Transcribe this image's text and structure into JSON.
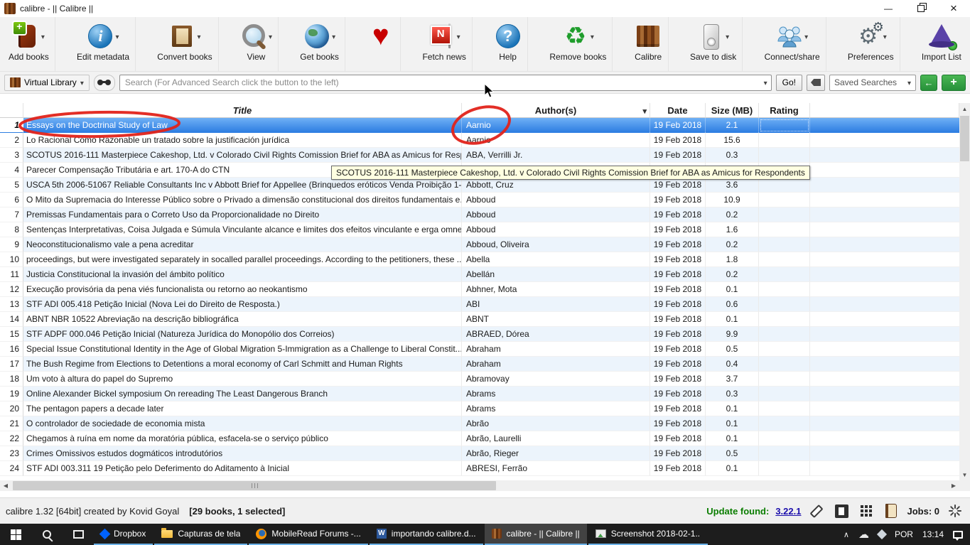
{
  "window": {
    "title": "calibre - || Calibre ||"
  },
  "toolbar": {
    "items": [
      {
        "label": "Add books"
      },
      {
        "label": "Edit metadata"
      },
      {
        "label": "Convert books"
      },
      {
        "label": "View"
      },
      {
        "label": "Get books"
      },
      {
        "label": ""
      },
      {
        "label": "Fetch news"
      },
      {
        "label": "Help"
      },
      {
        "label": "Remove books"
      },
      {
        "label": "Calibre"
      },
      {
        "label": "Save to disk"
      },
      {
        "label": "Connect/share"
      },
      {
        "label": "Preferences"
      },
      {
        "label": "Import List"
      }
    ]
  },
  "search": {
    "virtual_library": "Virtual Library",
    "placeholder": "Search (For Advanced Search click the button to the left)",
    "go": "Go!",
    "saved_searches": "Saved Searches"
  },
  "table": {
    "columns": {
      "title": "Title",
      "author": "Author(s)",
      "date": "Date",
      "size": "Size (MB)",
      "rating": "Rating"
    },
    "rows": [
      {
        "num": "1",
        "title": "Essays on the Doctrinal Study of Law",
        "author": "Aarnio",
        "date": "19 Feb 2018",
        "size": "2.1",
        "rating": "",
        "selected": true
      },
      {
        "num": "2",
        "title": "Lo Racional Como Razonable un tratado sobre la justificación jurídica",
        "author": "Aarnio",
        "date": "19 Feb 2018",
        "size": "15.6",
        "rating": ""
      },
      {
        "num": "3",
        "title": "SCOTUS 2016-111 Masterpiece Cakeshop, Ltd. v Colorado Civil Rights Comission Brief for ABA as Amicus for Resp...",
        "author": "ABA, Verrilli Jr.",
        "date": "19 Feb 2018",
        "size": "0.3",
        "rating": ""
      },
      {
        "num": "4",
        "title": "Parecer Compensação Tributária e art. 170-A do CTN",
        "author": "",
        "date": "",
        "size": "",
        "rating": ""
      },
      {
        "num": "5",
        "title": "USCA 5th 2006-51067 Reliable Consultants Inc v Abbott Brief for Appellee (Brinquedos eróticos Venda Proibição 1-...",
        "author": "Abbott, Cruz",
        "date": "19 Feb 2018",
        "size": "3.6",
        "rating": ""
      },
      {
        "num": "6",
        "title": "O Mito da Supremacia do Interesse Público sobre o Privado a dimensão constitucional dos direitos fundamentais e...",
        "author": "Abboud",
        "date": "19 Feb 2018",
        "size": "10.9",
        "rating": ""
      },
      {
        "num": "7",
        "title": "Premissas Fundamentais para o Correto Uso da Proporcionalidade no Direito",
        "author": "Abboud",
        "date": "19 Feb 2018",
        "size": "0.2",
        "rating": ""
      },
      {
        "num": "8",
        "title": "Sentenças Interpretativas, Coisa Julgada e Súmula Vinculante alcance e limites dos efeitos vinculante e erga omnes...",
        "author": "Abboud",
        "date": "19 Feb 2018",
        "size": "1.6",
        "rating": ""
      },
      {
        "num": "9",
        "title": "Neoconstitucionalismo vale a pena acreditar",
        "author": "Abboud, Oliveira",
        "date": "19 Feb 2018",
        "size": "0.2",
        "rating": ""
      },
      {
        "num": "10",
        "title": "proceedings, but were investigated separately in socalled parallel proceedings. According to the petitioners, these ...",
        "author": "Abella",
        "date": "19 Feb 2018",
        "size": "1.8",
        "rating": ""
      },
      {
        "num": "11",
        "title": "Justicia Constitucional la invasión del ámbito político",
        "author": "Abellán",
        "date": "19 Feb 2018",
        "size": "0.2",
        "rating": ""
      },
      {
        "num": "12",
        "title": "Execução provisória da pena viés funcionalista ou retorno ao neokantismo",
        "author": "Abhner, Mota",
        "date": "19 Feb 2018",
        "size": "0.1",
        "rating": ""
      },
      {
        "num": "13",
        "title": "STF ADI 005.418 Petição Inicial (Nova Lei do Direito de Resposta.)",
        "author": "ABI",
        "date": "19 Feb 2018",
        "size": "0.6",
        "rating": ""
      },
      {
        "num": "14",
        "title": "ABNT NBR 10522 Abreviação na descrição bibliográfica",
        "author": "ABNT",
        "date": "19 Feb 2018",
        "size": "0.1",
        "rating": ""
      },
      {
        "num": "15",
        "title": "STF ADPF 000.046 Petição Inicial (Natureza Jurídica do Monopólio dos Correios)",
        "author": "ABRAED, Dórea",
        "date": "19 Feb 2018",
        "size": "9.9",
        "rating": ""
      },
      {
        "num": "16",
        "title": "Special Issue Constitutional Identity in the Age of Global Migration 5-Immigration as a Challenge to Liberal Constit...",
        "author": "Abraham",
        "date": "19 Feb 2018",
        "size": "0.5",
        "rating": ""
      },
      {
        "num": "17",
        "title": "The Bush Regime from Elections to Detentions a moral economy of Carl Schmitt and Human Rights",
        "author": "Abraham",
        "date": "19 Feb 2018",
        "size": "0.4",
        "rating": ""
      },
      {
        "num": "18",
        "title": "Um voto à altura do papel do Supremo",
        "author": "Abramovay",
        "date": "19 Feb 2018",
        "size": "3.7",
        "rating": ""
      },
      {
        "num": "19",
        "title": "Online Alexander Bickel symposium On rereading The Least Dangerous Branch",
        "author": "Abrams",
        "date": "19 Feb 2018",
        "size": "0.3",
        "rating": ""
      },
      {
        "num": "20",
        "title": "The pentagon papers a decade later",
        "author": "Abrams",
        "date": "19 Feb 2018",
        "size": "0.1",
        "rating": ""
      },
      {
        "num": "21",
        "title": "O controlador de sociedade de economia mista",
        "author": "Abrão",
        "date": "19 Feb 2018",
        "size": "0.1",
        "rating": ""
      },
      {
        "num": "22",
        "title": "Chegamos à ruína em nome da moratória pública, esfacela-se o serviço público",
        "author": "Abrão, Laurelli",
        "date": "19 Feb 2018",
        "size": "0.1",
        "rating": ""
      },
      {
        "num": "23",
        "title": "Crimes Omissivos estudos dogmáticos introdutórios",
        "author": "Abrão, Rieger",
        "date": "19 Feb 2018",
        "size": "0.5",
        "rating": ""
      },
      {
        "num": "24",
        "title": "STF ADI 003.311 19 Petição pelo Deferimento do Aditamento à Inicial",
        "author": "ABRESI, Ferrão",
        "date": "19 Feb 2018",
        "size": "0.1",
        "rating": ""
      }
    ]
  },
  "tooltip": {
    "text": "SCOTUS 2016-111 Masterpiece Cakeshop, Ltd. v Colorado Civil Rights Comission Brief for ABA as Amicus for Respondents"
  },
  "statusbar": {
    "app_info": "calibre 1.32 [64bit] created by Kovid Goyal",
    "selection_info": "[29 books, 1 selected]",
    "update_label": "Update found:",
    "update_version": "3.22.1",
    "jobs_label": "Jobs: 0"
  },
  "taskbar": {
    "apps": [
      {
        "label": "Dropbox"
      },
      {
        "label": "Capturas de tela"
      },
      {
        "label": "MobileRead Forums -..."
      },
      {
        "label": "importando calibre.d..."
      },
      {
        "label": "calibre - || Calibre ||"
      },
      {
        "label": "Screenshot 2018-02-1..."
      }
    ],
    "language": "POR",
    "time": "13:14"
  }
}
